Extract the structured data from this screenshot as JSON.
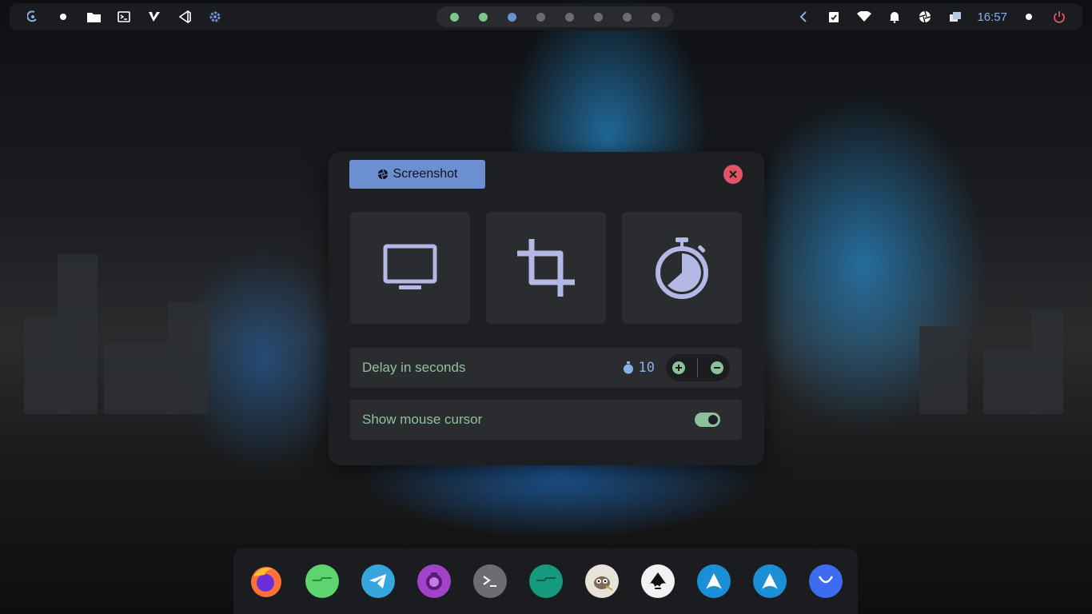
{
  "topbar": {
    "left_icons": [
      "debian-swirl-icon",
      "dot-icon",
      "folder-icon",
      "terminal-icon",
      "vim-icon",
      "vscode-icon",
      "settings-gear-icon"
    ],
    "workspaces": [
      {
        "color": "#7fc58c"
      },
      {
        "color": "#7fc58c"
      },
      {
        "color": "#6b8fd0"
      },
      {
        "color": "#6b6c6e"
      },
      {
        "color": "#6b6c6e"
      },
      {
        "color": "#6b6c6e"
      },
      {
        "color": "#6b6c6e"
      },
      {
        "color": "#6b6c6e"
      }
    ],
    "right_icons": [
      "chevron-left-icon",
      "checklist-icon",
      "wifi-icon",
      "notification-bell-icon",
      "screenshot-aperture-icon",
      "windows-icon"
    ],
    "clock": "16:57"
  },
  "dialog": {
    "title": "Screenshot",
    "modes": [
      "fullscreen-monitor-icon",
      "crop-region-icon",
      "timer-stopwatch-icon"
    ],
    "delay": {
      "label": "Delay in seconds",
      "value": "10"
    },
    "cursor": {
      "label": "Show mouse cursor",
      "enabled": true
    }
  },
  "dock": {
    "apps": [
      "firefox",
      "files",
      "telegram",
      "camera",
      "terminal",
      "folder",
      "gimp",
      "inkscape",
      "arch-installer",
      "arch-installer-alt",
      "smile"
    ]
  },
  "colors": {
    "accent_blue": "#6b8fd0",
    "accent_green": "#8ec19a",
    "close_red": "#e05564",
    "power_red": "#e05564"
  }
}
